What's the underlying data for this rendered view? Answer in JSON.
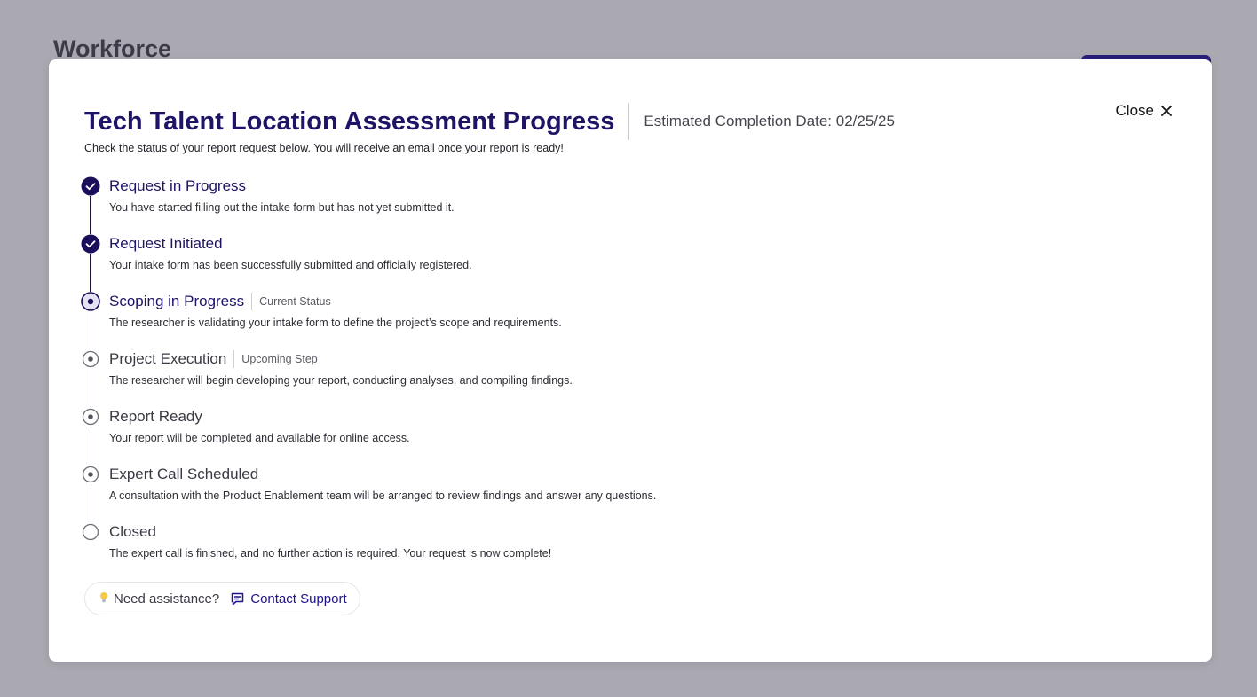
{
  "background": {
    "title": "Workforce"
  },
  "modal": {
    "title": "Tech Talent Location Assessment Progress",
    "estimated_completion": "Estimated Completion Date: 02/25/25",
    "close_label": "Close",
    "subtitle": "Check the status of your report request below. You will receive an email once your report is ready!",
    "steps": [
      {
        "title": "Request in Progress",
        "description": "You have started filling out the intake form but has not yet submitted it.",
        "state": "done",
        "tag": ""
      },
      {
        "title": "Request Initiated",
        "description": "Your intake form has been successfully submitted and officially registered.",
        "state": "done",
        "tag": ""
      },
      {
        "title": "Scoping in Progress",
        "description": "The researcher is validating your intake form to define the project’s scope and requirements.",
        "state": "current",
        "tag": "Current Status"
      },
      {
        "title": "Project Execution",
        "description": "The researcher will begin developing your report, conducting analyses, and compiling findings.",
        "state": "upcoming",
        "tag": "Upcoming Step"
      },
      {
        "title": "Report Ready",
        "description": "Your report will be completed and available for online access.",
        "state": "upcoming",
        "tag": ""
      },
      {
        "title": "Expert Call Scheduled",
        "description": "A consultation with the Product Enablement team will be arranged to review findings and answer any questions.",
        "state": "upcoming",
        "tag": ""
      },
      {
        "title": "Closed",
        "description": "The expert call is finished, and no further action is required. Your request is now complete!",
        "state": "final",
        "tag": ""
      }
    ],
    "help": {
      "need_assistance": "Need assistance?",
      "contact_support": "Contact Support",
      "icons": [
        "lightbulb-icon",
        "chat-icon"
      ]
    }
  },
  "colors": {
    "accent": "#1e1466",
    "overlay": "#aaa9b2",
    "step_done": "#1b0f5c",
    "step_upcoming": "#8f8f99"
  }
}
